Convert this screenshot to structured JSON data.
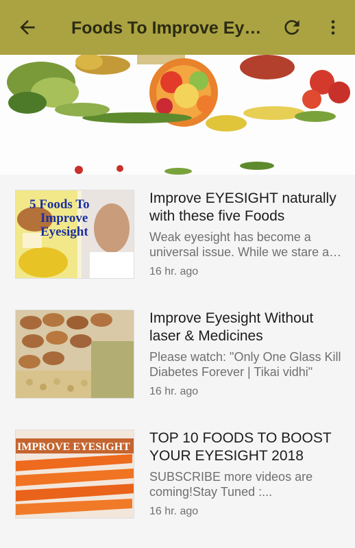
{
  "header": {
    "title": "Foods To Improve Eyesight"
  },
  "icons": {
    "back": "arrow-back-icon",
    "refresh": "refresh-icon",
    "more": "more-vert-icon"
  },
  "items": [
    {
      "title": "Improve EYESIGHT naturally with these five Foods",
      "description": "Weak eyesight has become a universal issue. While we stare at screens all day",
      "time": "16 hr. ago",
      "thumb_text": [
        "5 Foods To",
        "Improve",
        "Eyesight"
      ]
    },
    {
      "title": "Improve Eyesight Without laser & Medicines",
      "description": "Please watch: \"Only One Glass Kill Diabetes Forever | Tikai vidhi\"",
      "time": "16 hr. ago"
    },
    {
      "title": "TOP 10 FOODS TO BOOST YOUR EYESIGHT 2018",
      "description": "SUBSCRIBE more videos are coming!Stay Tuned :...",
      "time": "16 hr. ago",
      "thumb_text": [
        "IMPROVE EYESIGHT"
      ]
    }
  ],
  "colors": {
    "appbar": "#aba342",
    "title_text": "#2b2b12",
    "background": "#f5f5f5"
  }
}
